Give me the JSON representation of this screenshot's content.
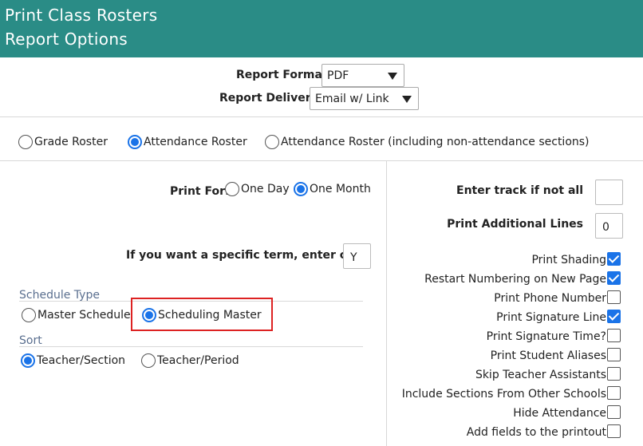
{
  "header": {
    "line1": "Print Class Rosters",
    "line2": "Report Options"
  },
  "report_format": {
    "label": "Report Format:",
    "value": "PDF"
  },
  "report_delivery": {
    "label": "Report Delivery:",
    "value": "Email w/ Link"
  },
  "roster_type": {
    "options": [
      "Grade Roster",
      "Attendance Roster",
      "Attendance Roster (including non-attendance sections)"
    ],
    "selected": "Attendance Roster"
  },
  "print_for": {
    "label": "Print For:",
    "options": [
      "One Day",
      "One Month"
    ],
    "selected": "One Month"
  },
  "term": {
    "label": "If you want a specific term, enter code",
    "value": "Y"
  },
  "schedule_type": {
    "title": "Schedule Type",
    "options": [
      "Master Schedule",
      "Scheduling Master"
    ],
    "selected": "Scheduling Master"
  },
  "sort": {
    "title": "Sort",
    "options": [
      "Teacher/Section",
      "Teacher/Period"
    ],
    "selected": "Teacher/Section"
  },
  "track": {
    "label": "Enter track if not all",
    "value": ""
  },
  "additional_lines": {
    "label": "Print Additional Lines",
    "value": "0"
  },
  "checkboxes": [
    {
      "label": "Print Shading",
      "checked": true
    },
    {
      "label": "Restart Numbering on New Page",
      "checked": true
    },
    {
      "label": "Print Phone Number",
      "checked": false
    },
    {
      "label": "Print Signature Line",
      "checked": true
    },
    {
      "label": "Print Signature Time?",
      "checked": false
    },
    {
      "label": "Print Student Aliases",
      "checked": false
    },
    {
      "label": "Skip Teacher Assistants",
      "checked": false
    },
    {
      "label": "Include Sections From Other Schools",
      "checked": false
    },
    {
      "label": "Hide Attendance",
      "checked": false
    },
    {
      "label": "Add fields to the printout",
      "checked": false
    }
  ],
  "colors": {
    "header_bg": "#2a8c86",
    "accent": "#1a73e8",
    "highlight": "#dd2222",
    "section_title": "#5a6f8f"
  }
}
